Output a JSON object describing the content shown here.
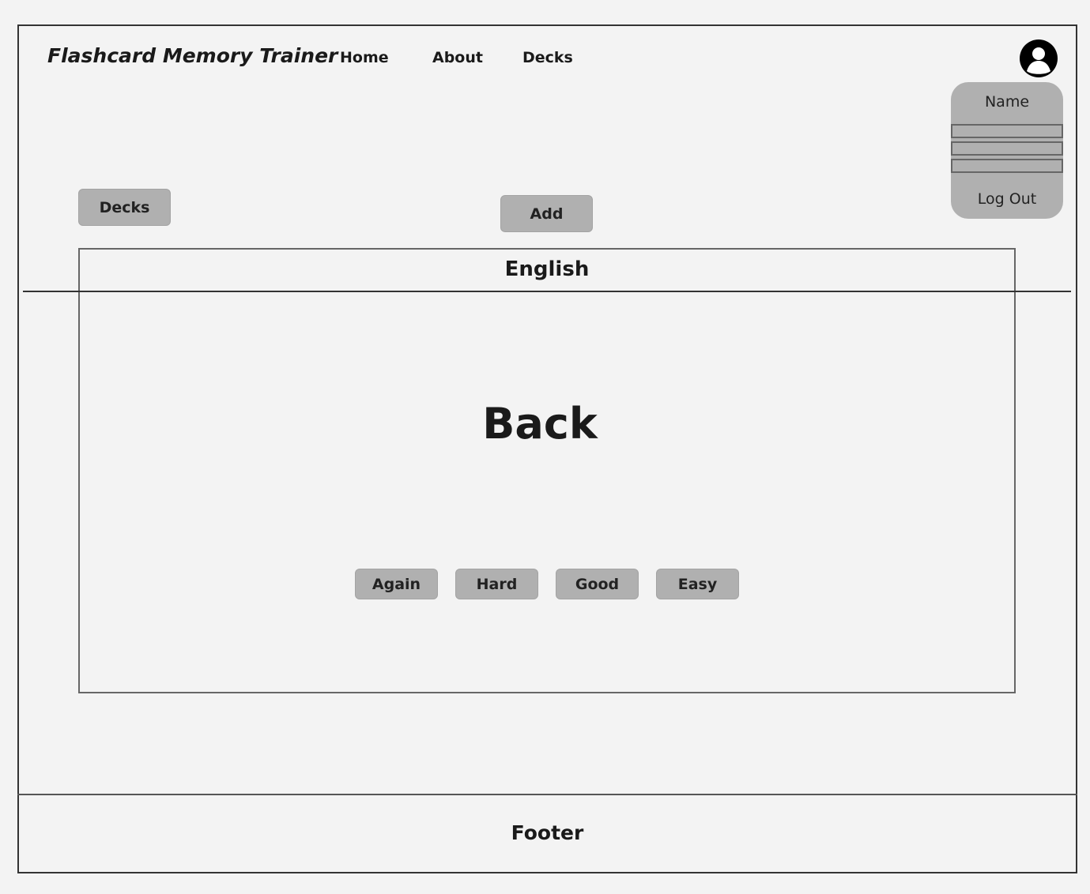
{
  "header": {
    "title": "Flashcard Memory Trainer",
    "nav": [
      {
        "label": "Home"
      },
      {
        "label": "About"
      },
      {
        "label": "Decks"
      }
    ]
  },
  "user_menu": {
    "avatar_icon": "user-avatar-icon",
    "name": "Name",
    "logout_label": "Log Out"
  },
  "toolbar": {
    "decks_label": "Decks",
    "add_label": "Add"
  },
  "card": {
    "deck_name": "English",
    "face_text": "Back",
    "ratings": [
      {
        "label": "Again"
      },
      {
        "label": "Hard"
      },
      {
        "label": "Good"
      },
      {
        "label": "Easy"
      }
    ]
  },
  "footer": {
    "text": "Footer"
  },
  "colors": {
    "background": "#f3f3f3",
    "button": "#b0b0b0",
    "border": "#333333"
  }
}
